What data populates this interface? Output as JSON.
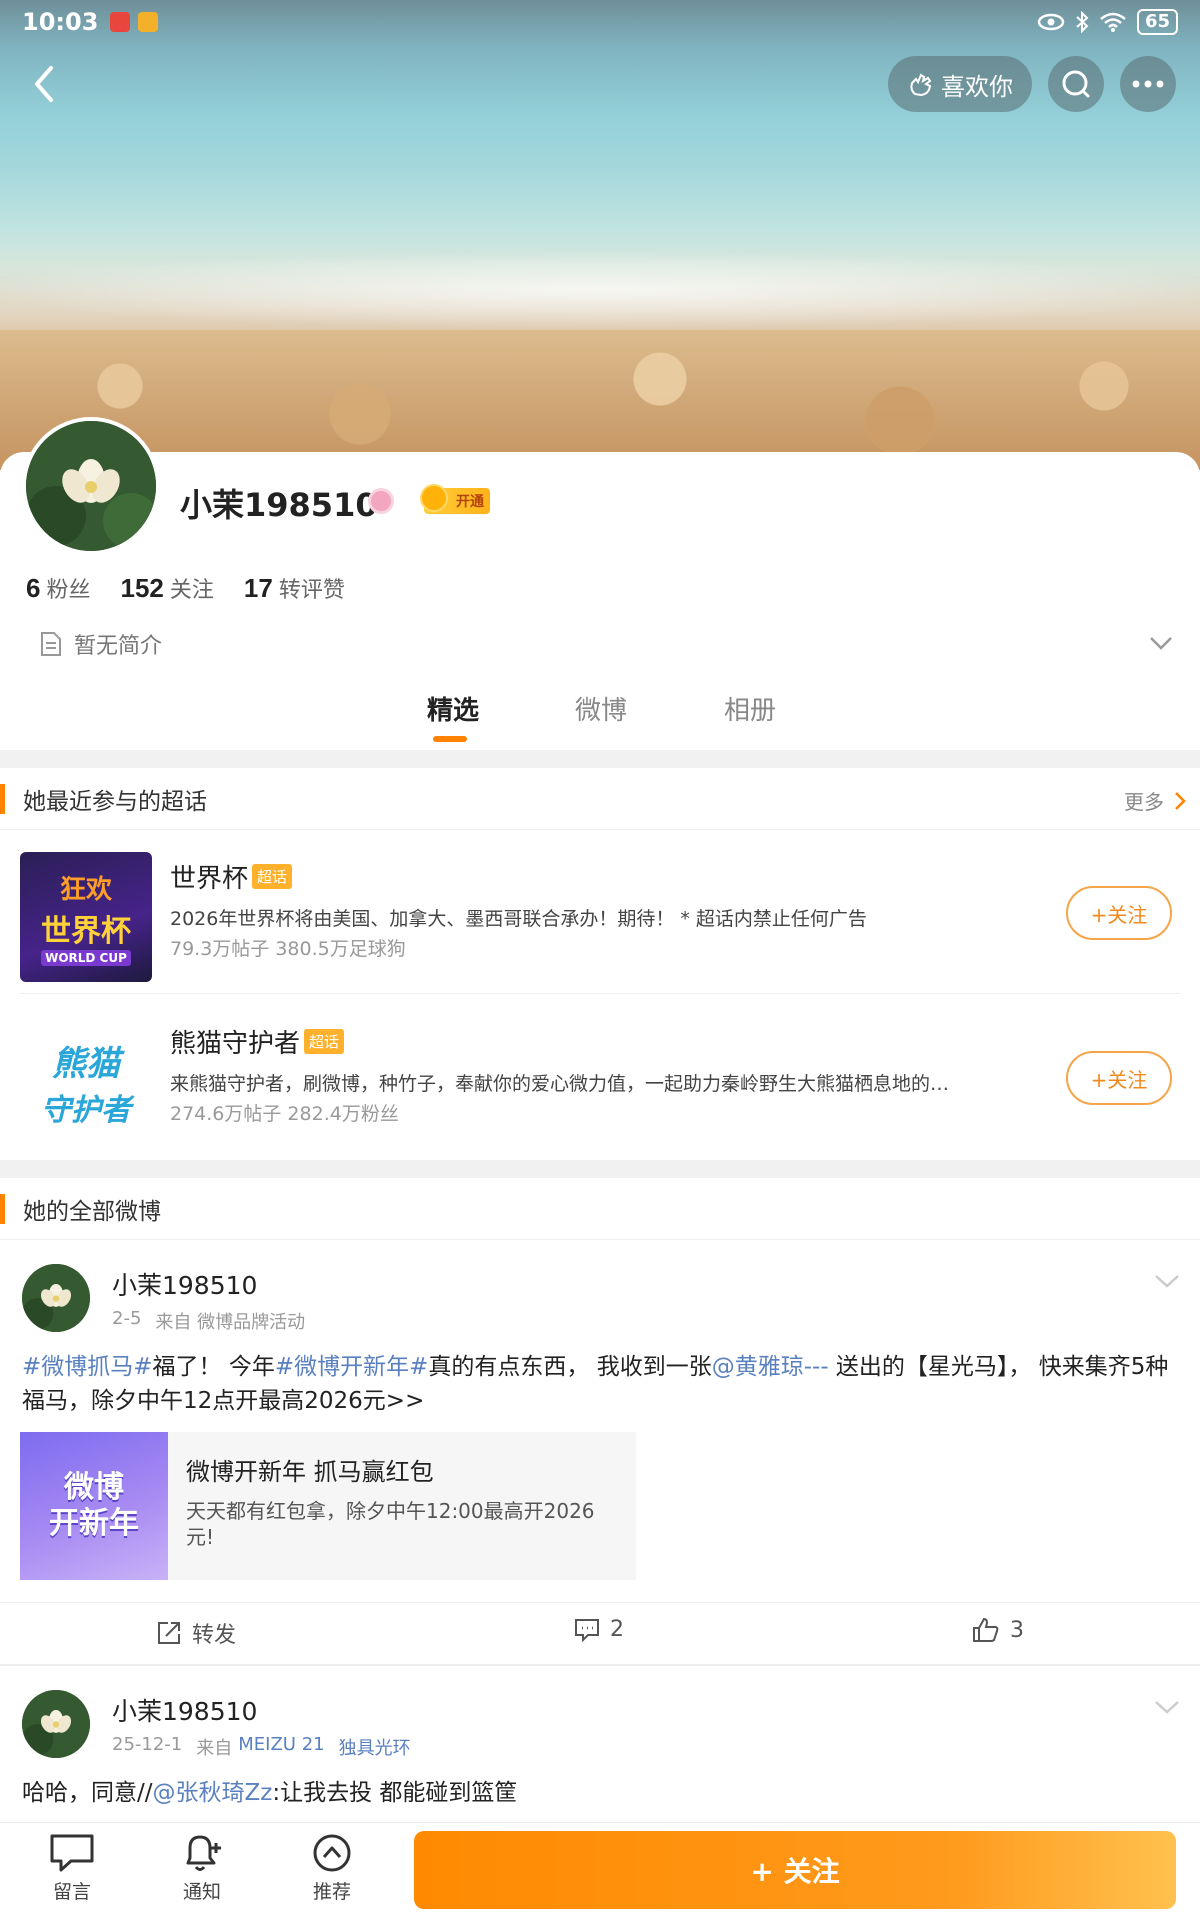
{
  "status_bar": {
    "time": "10:03",
    "battery": "65"
  },
  "header": {
    "like_label": "喜欢你"
  },
  "profile": {
    "username": "小茉198510",
    "vip_label": "开通",
    "stats": [
      {
        "value": "6",
        "label": "粉丝"
      },
      {
        "value": "152",
        "label": "关注"
      },
      {
        "value": "17",
        "label": "转评赞"
      }
    ],
    "bio": "暂无简介"
  },
  "tabs": [
    "精选",
    "微博",
    "相册"
  ],
  "active_tab": "精选",
  "supertopics": {
    "title": "她最近参与的超话",
    "more_label": "更多",
    "tag_label": "超话",
    "follow_label": "+关注",
    "items": [
      {
        "name": "世界杯",
        "thumb_text": [
          "狂欢",
          "世界杯",
          "WORLD CUP"
        ],
        "desc": "2026年世界杯将由美国、加拿大、墨西哥联合承办！期待！ * 超话内禁止任何广告",
        "meta": "79.3万帖子 380.5万足球狗"
      },
      {
        "name": "熊猫守护者",
        "thumb_text": [
          "熊猫",
          "守护者"
        ],
        "desc": "来熊猫守护者，刷微博，种竹子，奉献你的爱心微力值，一起助力秦岭野生大熊猫栖息地的…",
        "meta": "274.6万帖子 282.4万粉丝"
      }
    ]
  },
  "posts_section": {
    "title": "她的全部微博"
  },
  "posts": [
    {
      "author": "小茉198510",
      "date": "2-5",
      "source": "来自 微博品牌活动",
      "content_parts": [
        {
          "t": "#微博抓马#",
          "link": true
        },
        {
          "t": "福了！ 今年",
          "link": false
        },
        {
          "t": "#微博开新年#",
          "link": true
        },
        {
          "t": "真的有点东西， 我收到一张",
          "link": false
        },
        {
          "t": "@黄雅琼---",
          "link": true
        },
        {
          "t": " 送出的【星光马】， 快来集齐5种福马，除夕中午12点开最高2026元>>",
          "link": false
        }
      ],
      "card": {
        "thumb_text": [
          "微博",
          "开新年"
        ],
        "title": "微博开新年 抓马赢红包",
        "desc": "天天都有红包拿，除夕中午12:00最高开2026元!"
      },
      "actions": {
        "repost": "转发",
        "comments": "2",
        "likes": "3"
      }
    },
    {
      "author": "小茉198510",
      "date": "25-12-1",
      "source_prefix": "来自",
      "source_device": "MEIZU 21",
      "source_tagline": "独具光环",
      "content_parts": [
        {
          "t": "哈哈，同意//",
          "link": false
        },
        {
          "t": "@张秋琦Zz",
          "link": true
        },
        {
          "t": ":让我去投 都能碰到篮筐",
          "link": false
        }
      ]
    }
  ],
  "bottom_nav": [
    {
      "label": "留言",
      "icon": "chat-icon"
    },
    {
      "label": "通知",
      "icon": "bell-icon"
    },
    {
      "label": "推荐",
      "icon": "recommend-icon"
    }
  ],
  "follow_button": "+ 关注",
  "colors": {
    "accent": "#ff8200",
    "link": "#5a80bf"
  }
}
